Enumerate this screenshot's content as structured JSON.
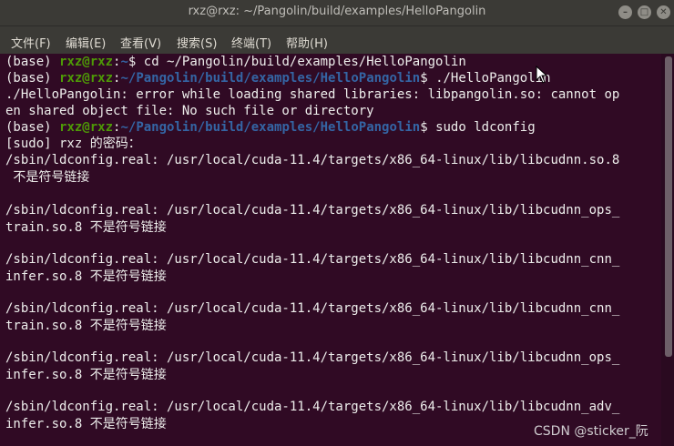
{
  "window": {
    "title": "rxz@rxz: ~/Pangolin/build/examples/HelloPangolin",
    "minimize_symbol": "–",
    "maximize_symbol": "□",
    "close_symbol": "✕"
  },
  "menu": {
    "items": [
      {
        "label": "文件(F)"
      },
      {
        "label": "编辑(E)"
      },
      {
        "label": "查看(V)"
      },
      {
        "label": "搜索(S)"
      },
      {
        "label": "终端(T)"
      },
      {
        "label": "帮助(H)"
      }
    ]
  },
  "terminal": {
    "prompt_base": "(base) ",
    "prompt_user": "rxz@rxz",
    "prompt_sep": ":",
    "prompt_home": "~",
    "prompt_path": "~/Pangolin/build/examples/HelloPangolin",
    "prompt_dollar": "$ ",
    "cmd1": "cd ~/Pangolin/build/examples/HelloPangolin",
    "cmd2": "./HelloPangolin",
    "error_line1": "./HelloPangolin: error while loading shared libraries: libpangolin.so: cannot op",
    "error_line2": "en shared object file: No such file or directory",
    "cmd3": "sudo ldconfig",
    "sudo_prompt": "[sudo] rxz 的密码：",
    "out1a": "/sbin/ldconfig.real: /usr/local/cuda-11.4/targets/x86_64-linux/lib/libcudnn.so.8",
    "out1b": " 不是符号链接",
    "out2a": "/sbin/ldconfig.real: /usr/local/cuda-11.4/targets/x86_64-linux/lib/libcudnn_ops_",
    "out2b": "train.so.8 不是符号链接",
    "out3a": "/sbin/ldconfig.real: /usr/local/cuda-11.4/targets/x86_64-linux/lib/libcudnn_cnn_",
    "out3b": "infer.so.8 不是符号链接",
    "out4a": "/sbin/ldconfig.real: /usr/local/cuda-11.4/targets/x86_64-linux/lib/libcudnn_cnn_",
    "out4b": "train.so.8 不是符号链接",
    "out5a": "/sbin/ldconfig.real: /usr/local/cuda-11.4/targets/x86_64-linux/lib/libcudnn_ops_",
    "out5b": "infer.so.8 不是符号链接",
    "out6a": "/sbin/ldconfig.real: /usr/local/cuda-11.4/targets/x86_64-linux/lib/libcudnn_adv_",
    "out6b": "infer.so.8 不是符号链接"
  },
  "watermark": "CSDN @sticker_阮",
  "colors": {
    "terminal_bg": "#300a24",
    "prompt_user": "#4e9a06",
    "prompt_path": "#3465a4",
    "text": "#eeeeec",
    "chrome": "#3b3a36"
  }
}
